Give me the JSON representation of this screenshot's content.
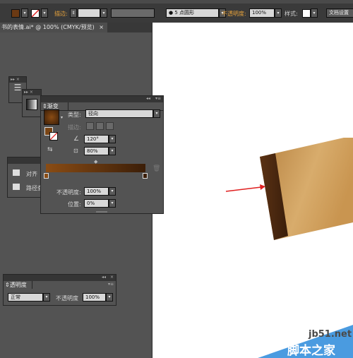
{
  "control_bar": {
    "stroke_label": "描边:",
    "brush_value": "5 点圆形",
    "opacity_label": "不透明度:",
    "opacity_value": "100%",
    "style_label": "样式:",
    "doc_settings_label": "文档设置"
  },
  "document_tab": {
    "title": "书的表情.ai* @ 100% (CMYK/预览)",
    "close_glyph": "×"
  },
  "gradient_panel": {
    "tab_label": "渐变",
    "type_label": "类型:",
    "type_value": "径向",
    "stroke_label": "描边:",
    "angle_value": "120°",
    "aspect_value": "80%",
    "opacity_label": "不透明度:",
    "opacity_value": "100%",
    "location_label": "位置:",
    "location_value": "0%",
    "colors": {
      "start": "#8a4c14",
      "end": "#3b1e08"
    }
  },
  "align_panel": {
    "align_label": "对齐",
    "pathfinder_label": "路径查"
  },
  "transparency_panel": {
    "tab_label": "透明度",
    "blend_value": "正常",
    "opacity_label": "不透明度",
    "opacity_value": "100%"
  },
  "watermark": {
    "site": "jb51.net",
    "name": "脚本之家"
  },
  "colors": {
    "arrow": "#e02020",
    "book_light": "#d7a866",
    "book_dark": "#4a2710"
  }
}
